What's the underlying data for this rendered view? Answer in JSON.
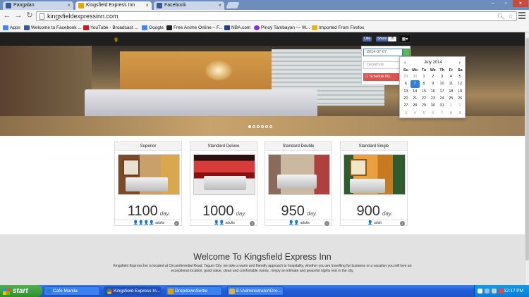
{
  "browser": {
    "tabs": [
      {
        "label": "Pangalan",
        "active": false,
        "color": "#3b5998"
      },
      {
        "label": "Kingsfield Express Inn",
        "active": true,
        "color": "#e3a800"
      },
      {
        "label": "Facebook",
        "active": false,
        "color": "#3b5998"
      }
    ],
    "url": "kingsfieldexpressinn.com",
    "bookmarks": [
      {
        "label": "Apps",
        "color": "#4285f4"
      },
      {
        "label": "Welcome to Facebook ...",
        "color": "#3b5998"
      },
      {
        "label": "YouTube - Broadcast ...",
        "color": "#cc181e"
      },
      {
        "label": "Google",
        "color": "#4285f4"
      },
      {
        "label": "Free Anime Online – F...",
        "color": "#222222"
      },
      {
        "label": "NBA.com",
        "color": "#1d428a"
      },
      {
        "label": "Pinoy Tambayan — W...",
        "color": "#8a2be2"
      },
      {
        "label": "Imported From Firefox",
        "color": "#e6b422"
      }
    ]
  },
  "site": {
    "social": {
      "like": "Like",
      "share": "Share",
      "count": "15"
    },
    "booking": {
      "arrival_value": "2014-07-07",
      "departure_placeholder": "Departure",
      "button_label": "☐ Schedule My..."
    },
    "calendar": {
      "month": "July 2014",
      "weekdays": [
        "Su",
        "Mo",
        "Tu",
        "We",
        "Th",
        "Fr",
        "Sa"
      ],
      "weeks": [
        [
          "29",
          "30",
          "1",
          "2",
          "3",
          "4",
          "5"
        ],
        [
          "6",
          "7",
          "8",
          "9",
          "10",
          "11",
          "12"
        ],
        [
          "13",
          "14",
          "15",
          "16",
          "17",
          "18",
          "19"
        ],
        [
          "20",
          "21",
          "22",
          "23",
          "24",
          "25",
          "26"
        ],
        [
          "27",
          "28",
          "29",
          "30",
          "31",
          "1",
          "2"
        ],
        [
          "3",
          "4",
          "5",
          "6",
          "7",
          "8",
          "9"
        ]
      ],
      "selected": "7"
    },
    "rooms": [
      {
        "title": "Superior",
        "price": "1100",
        "unit": "day.",
        "people": "👤👤👤👤",
        "cap": "adults",
        "palette": [
          "#7a4a2a",
          "#c9a06a",
          "#d9a84e"
        ]
      },
      {
        "title": "Standard Deluxe",
        "price": "1000",
        "unit": "day.",
        "people": "👤👤",
        "cap": "adults",
        "palette": [
          "#8a0f0f",
          "#d93a3a",
          "#2a1010"
        ]
      },
      {
        "title": "Standard Double",
        "price": "950",
        "unit": "day.",
        "people": "👤👤",
        "cap": "adults",
        "palette": [
          "#8a6a5a",
          "#cbb8a0",
          "#b04040"
        ]
      },
      {
        "title": "Standard Single",
        "price": "900",
        "unit": "day.",
        "people": "👤",
        "cap": "adult",
        "palette": [
          "#c87a20",
          "#e9a040",
          "#2f5c2f"
        ]
      }
    ],
    "welcome": {
      "title": "Welcome To Kingsfield Express Inn",
      "text": "Kingsfield Express Inn is located at Circumferential Road, Tagum City. we take a warm and friendly approach to hospitality, whether you are travelling for business or a vacation you will love an exceptional location, good value, clean and comfortable rooms . Enjoy an intimate and peaceful nights rest in the city."
    }
  },
  "taskbar": {
    "start": "start",
    "tasks": [
      {
        "label": "Cafe Manila",
        "color": "#2a7dd8"
      },
      {
        "label": "Kingsfield Express In...",
        "color": "#e3a800"
      },
      {
        "label": "DropdownSettle",
        "color": "#d9a400"
      },
      {
        "label": "E:\\Administrator\\Dro...",
        "color": "#e0b040"
      }
    ],
    "time": "12:17 PM"
  }
}
